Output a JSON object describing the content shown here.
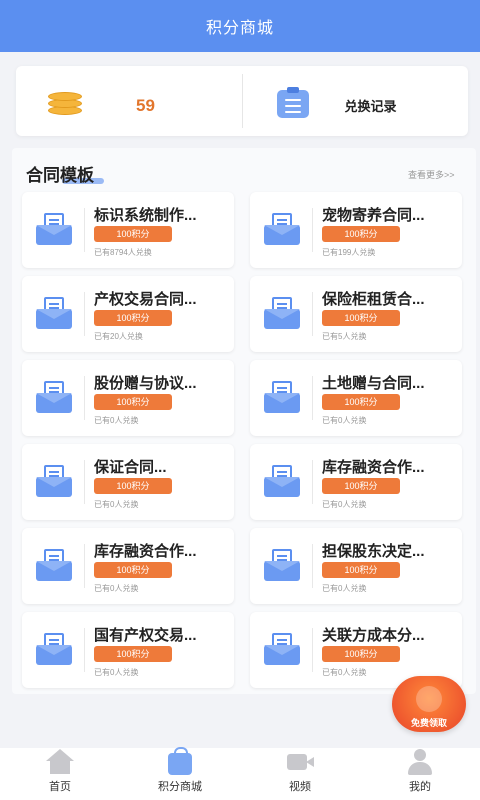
{
  "header": {
    "title": "积分商城"
  },
  "stats": {
    "points": "59",
    "record_label": "兑换记录"
  },
  "section": {
    "title": "合同模板",
    "more": "查看更多>>"
  },
  "cards": [
    {
      "name": "标识系统制作...",
      "price": "100积分",
      "redeemed": "已有8794人兑换"
    },
    {
      "name": "宠物寄养合同...",
      "price": "100积分",
      "redeemed": "已有199人兑换"
    },
    {
      "name": "产权交易合同...",
      "price": "100积分",
      "redeemed": "已有20人兑换"
    },
    {
      "name": "保险柜租赁合...",
      "price": "100积分",
      "redeemed": "已有5人兑换"
    },
    {
      "name": "股份赠与协议...",
      "price": "100积分",
      "redeemed": "已有0人兑换"
    },
    {
      "name": "土地赠与合同...",
      "price": "100积分",
      "redeemed": "已有0人兑换"
    },
    {
      "name": "保证合同...",
      "price": "100积分",
      "redeemed": "已有0人兑换"
    },
    {
      "name": "库存融资合作...",
      "price": "100积分",
      "redeemed": "已有0人兑换"
    },
    {
      "name": "库存融资合作...",
      "price": "100积分",
      "redeemed": "已有0人兑换"
    },
    {
      "name": "担保股东决定...",
      "price": "100积分",
      "redeemed": "已有0人兑换"
    },
    {
      "name": "国有产权交易...",
      "price": "100积分",
      "redeemed": "已有0人兑换"
    },
    {
      "name": "关联方成本分...",
      "price": "100积分",
      "redeemed": "已有0人兑换"
    }
  ],
  "float_button": {
    "label": "免费领取"
  },
  "tabbar": {
    "home": "首页",
    "mall": "积分商城",
    "video": "视频",
    "mine": "我的"
  },
  "colors": {
    "header": "#5b8ff0",
    "accent": "#ee7a3a",
    "points": "#e2762d"
  },
  "icons": {
    "coins": "coins-icon",
    "record": "clipboard-icon",
    "contract": "envelope-icon"
  }
}
